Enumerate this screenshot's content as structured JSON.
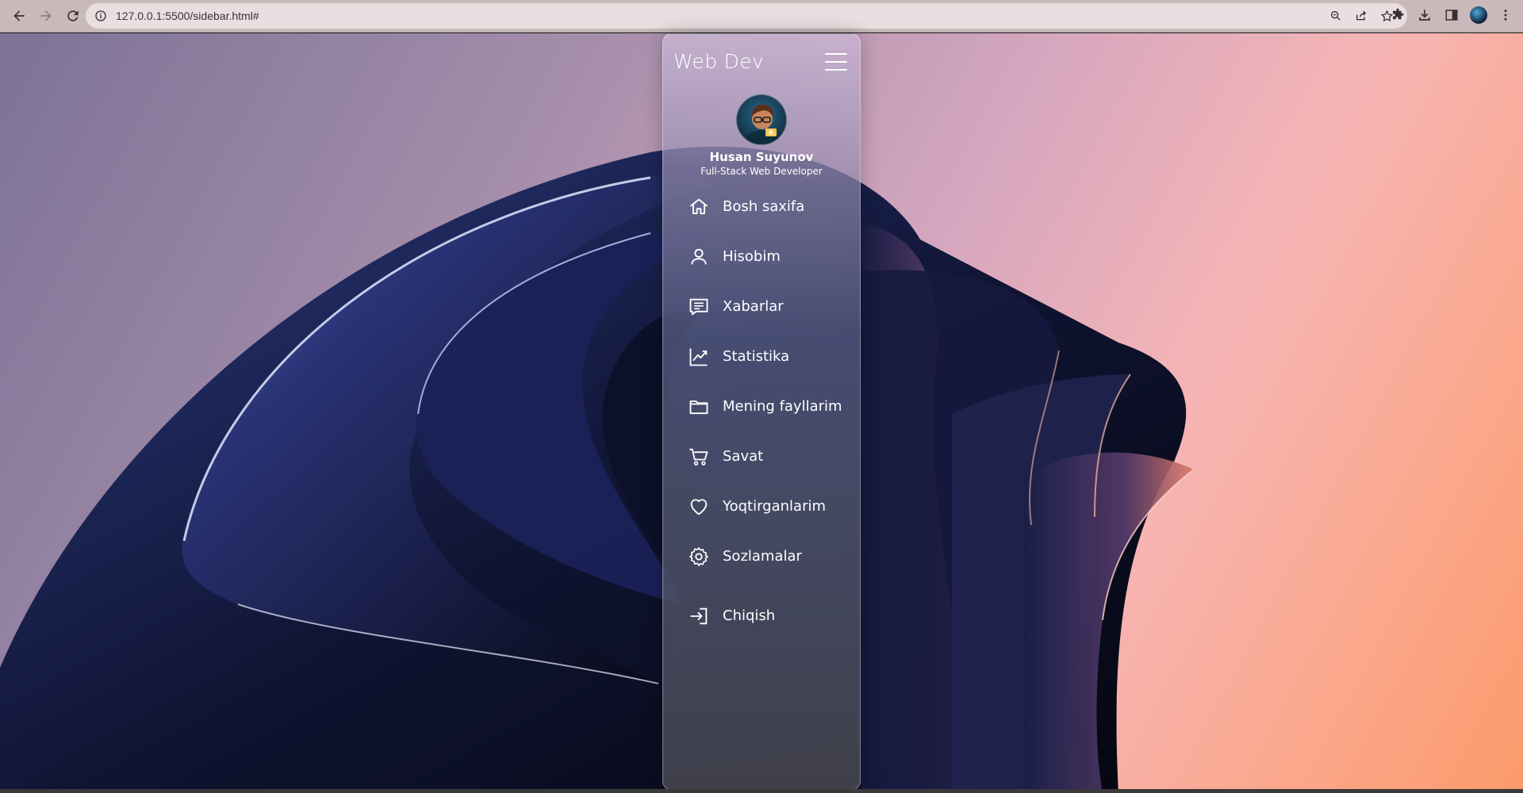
{
  "browser": {
    "url": "127.0.0.1:5500/sidebar.html#",
    "icons": [
      "back-icon",
      "forward-icon",
      "reload-icon",
      "info-icon",
      "zoom-icon",
      "share-icon",
      "star-icon",
      "extensions-icon",
      "download-icon",
      "sidepanel-icon",
      "profile-avatar",
      "kebab-menu-icon"
    ]
  },
  "sidebar": {
    "brand": "Web Dev",
    "user": {
      "name": "Husan Suyunov",
      "role": "Full-Stack Web Developer"
    },
    "items": [
      {
        "label": "Bosh saxifa",
        "icon": "home-icon"
      },
      {
        "label": "Hisobim",
        "icon": "user-icon"
      },
      {
        "label": "Xabarlar",
        "icon": "message-icon"
      },
      {
        "label": "Statistika",
        "icon": "chart-icon"
      },
      {
        "label": "Mening fayllarim",
        "icon": "folder-icon"
      },
      {
        "label": "Savat",
        "icon": "cart-icon"
      },
      {
        "label": "Yoqtirganlarim",
        "icon": "heart-icon"
      },
      {
        "label": "Sozlamalar",
        "icon": "gear-icon"
      }
    ],
    "logout": {
      "label": "Chiqish",
      "icon": "logout-icon"
    }
  },
  "colors": {
    "chrome": "#c9b9bb",
    "text": "#ffffff",
    "wallpaper_dark": "#0d1020",
    "wallpaper_accent": "#fba78a"
  }
}
